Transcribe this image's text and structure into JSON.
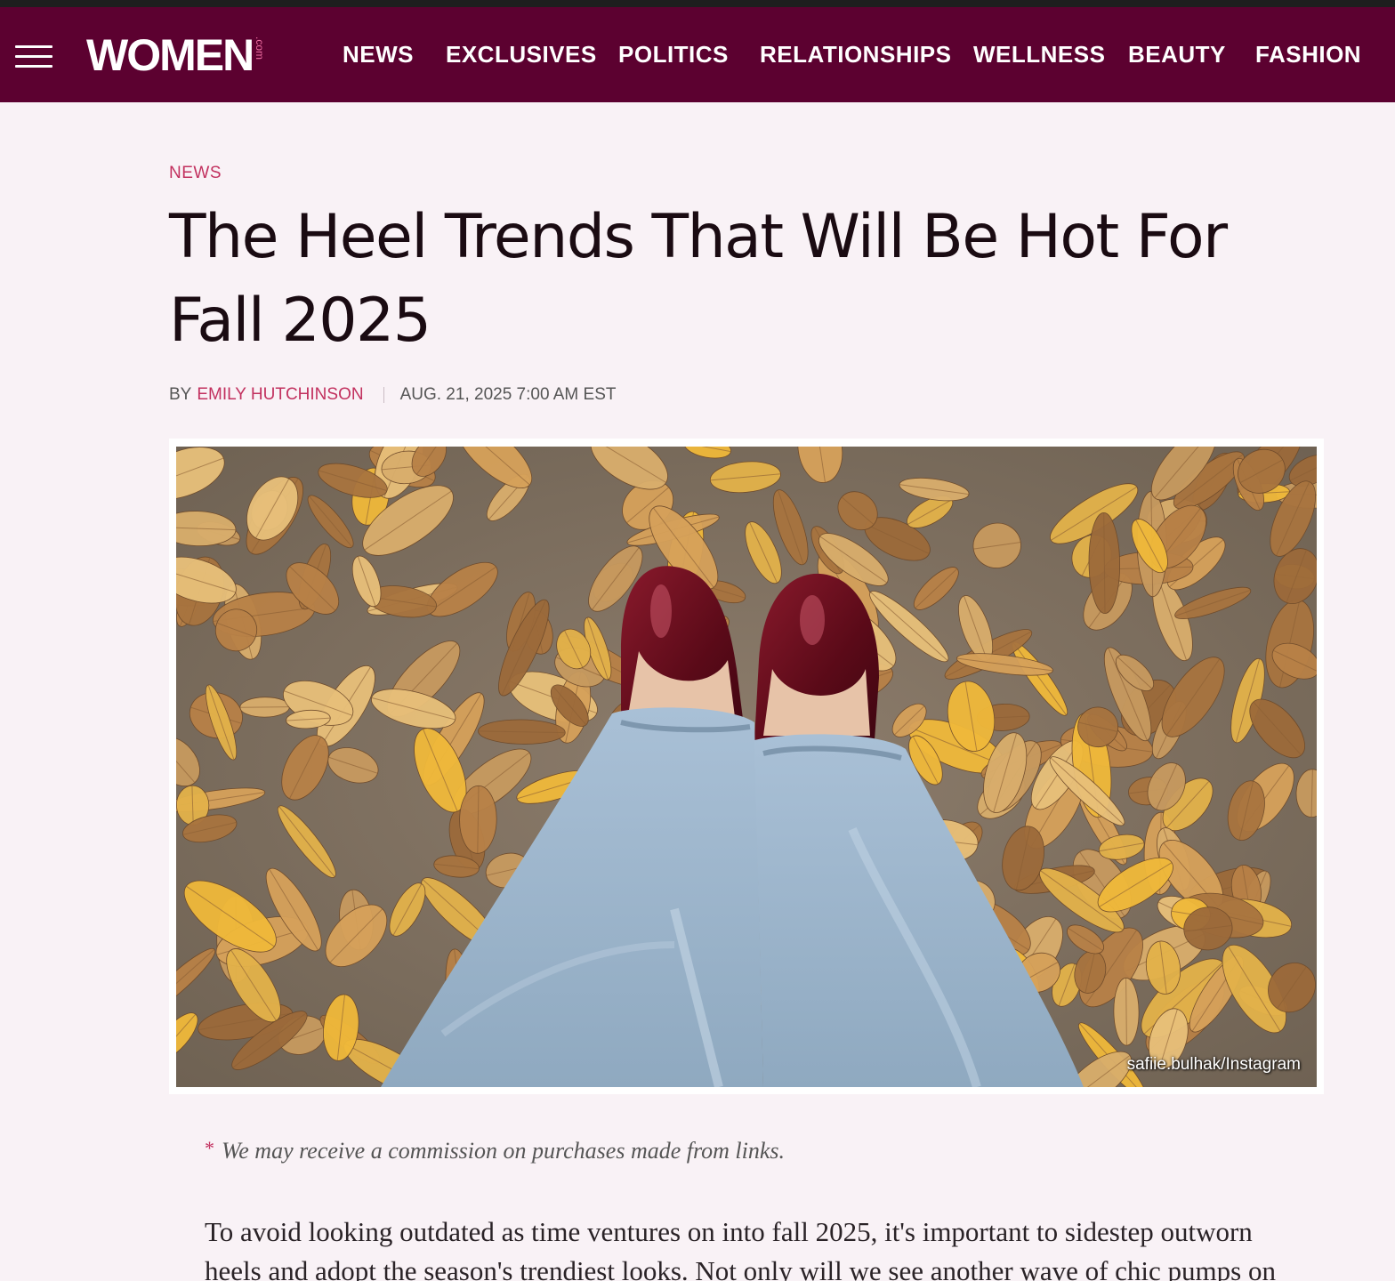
{
  "header": {
    "logo_text": "WOMEN",
    "logo_suffix": ".com",
    "nav": [
      "NEWS",
      "EXCLUSIVES",
      "POLITICS",
      "RELATIONSHIPS",
      "WELLNESS",
      "BEAUTY",
      "FASHION"
    ],
    "background_color": "#5c0130"
  },
  "article": {
    "section": "NEWS",
    "title": "The Heel Trends That Will Be Hot For Fall 2025",
    "byline_prefix": "BY",
    "author": "EMILY HUTCHINSON",
    "date": "AUG. 21, 2025 7:00 AM EST",
    "image_credit": "safiie.bulhak/Instagram",
    "disclaimer": "We may receive a commission on purchases made from links.",
    "body_first": "To avoid looking outdated as time ventures on into fall 2025, it's important to sidestep outworn heels and adopt the season's trendiest looks. Not only will we see another wave of chic pumps on"
  },
  "colors": {
    "accent": "#c2315f",
    "page_background": "#f9f2f6"
  }
}
